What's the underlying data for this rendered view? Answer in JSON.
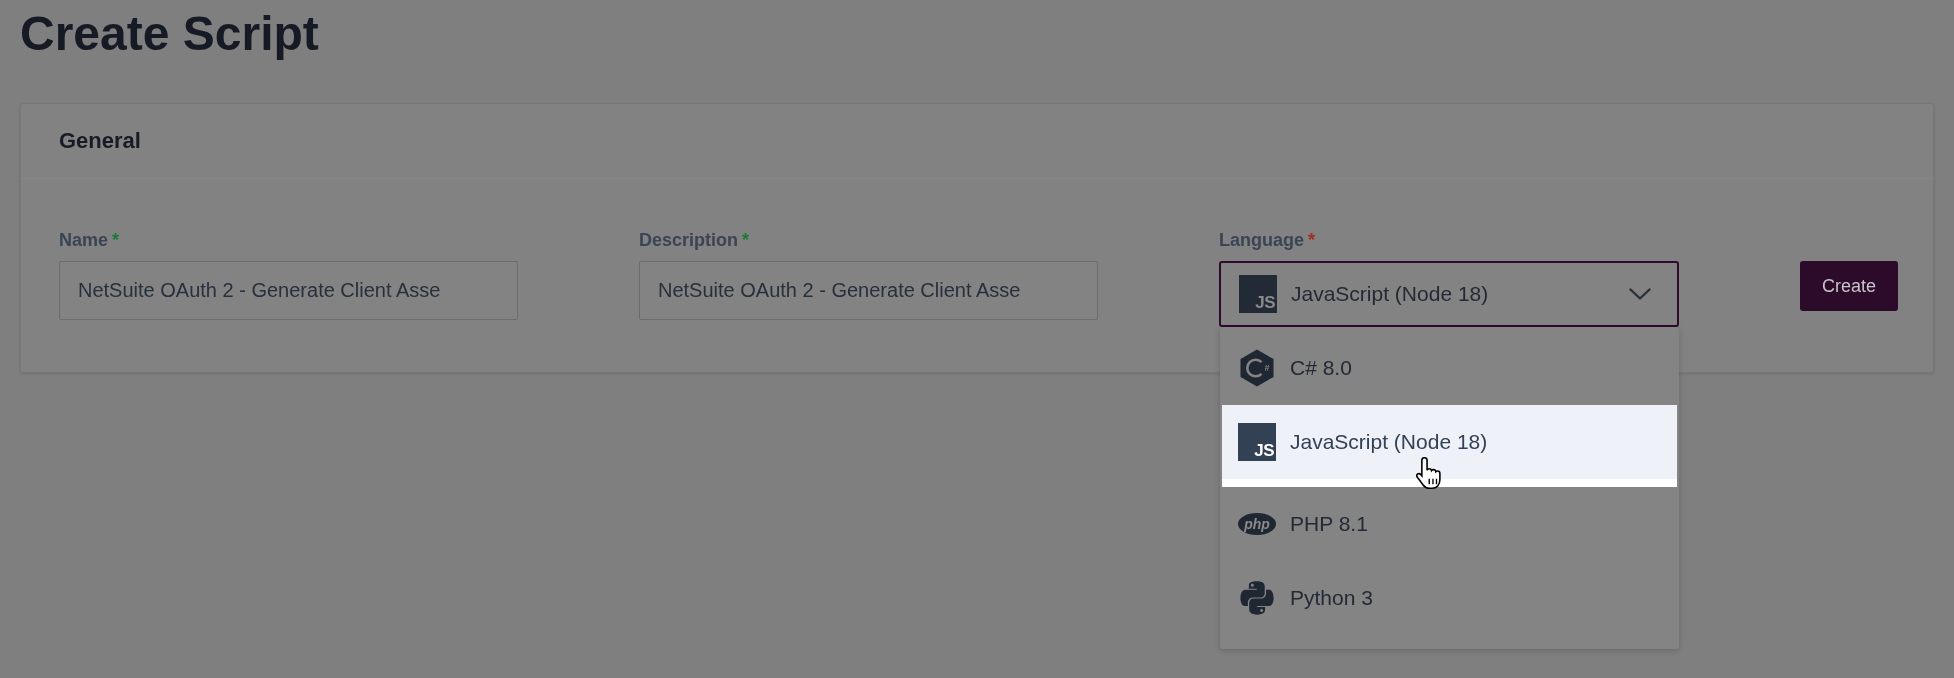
{
  "page": {
    "title": "Create Script"
  },
  "general": {
    "title": "General",
    "fields": [
      {
        "kind": "input",
        "label": "Name",
        "required_mark": "*",
        "color": "#1c7a34",
        "value": "NetSuite OAuth 2 - Generate Client Asse"
      },
      {
        "kind": "input",
        "label": "Description",
        "required_mark": "*",
        "color": "#1c7a34",
        "value": "NetSuite OAuth 2 - Generate Client Asse"
      },
      {
        "kind": "select",
        "label": "Language",
        "required_mark": "*",
        "color": "#a02c1c",
        "expanded": true,
        "current": {
          "kind": "javascript",
          "logo_text": "JS",
          "label": "JavaScript (Node 18)"
        },
        "options": [
          {
            "kind": "csharp",
            "logo_text": "#",
            "label": "C# 8.0",
            "selected": false,
            "hovered": false
          },
          {
            "kind": "javascript",
            "logo_text": "JS",
            "label": "JavaScript (Node 18)",
            "selected": true,
            "hovered": true
          },
          {
            "kind": "php",
            "logo_text": "php",
            "label": "PHP 8.1",
            "selected": false,
            "hovered": false
          },
          {
            "kind": "python",
            "label": "Python 3",
            "selected": false,
            "hovered": false
          }
        ]
      }
    ],
    "create_button": "Create"
  }
}
